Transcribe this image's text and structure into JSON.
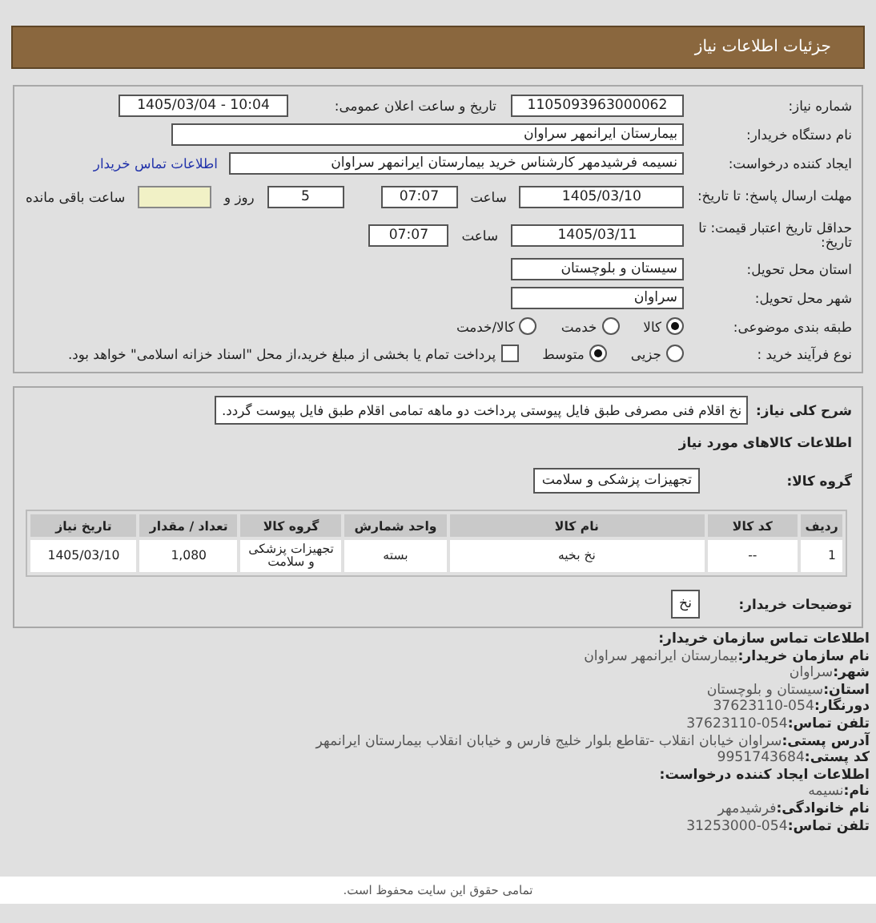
{
  "header": {
    "title": "جزئیات اطلاعات نیاز"
  },
  "need": {
    "number": {
      "label": "شماره نیاز:",
      "value": "1105093963000062"
    },
    "announce": {
      "label": "تاریخ و ساعت اعلان عمومی:",
      "value": "1405/03/04 - 10:04"
    },
    "buyer": {
      "label": "نام دستگاه خریدار:",
      "value": "بیمارستان ایرانمهر سراوان"
    },
    "creator": {
      "label": "ایجاد کننده درخواست:",
      "value": "نسیمه فرشیدمهر کارشناس خرید بیمارستان ایرانمهر سراوان",
      "link": "اطلاعات تماس خریدار"
    },
    "deadline": {
      "label": "مهلت ارسال پاسخ: تا تاریخ:",
      "date": "1405/03/10",
      "time_label": "ساعت",
      "time": "07:07",
      "days": "5",
      "days_label": "روز و",
      "remaining_label": "ساعت باقی مانده"
    },
    "validity": {
      "label": "حداقل تاریخ اعتبار قیمت: تا تاریخ:",
      "date": "1405/03/11",
      "time_label": "ساعت",
      "time": "07:07"
    },
    "province": {
      "label": "استان محل تحویل:",
      "value": "سیستان و بلوچستان"
    },
    "city": {
      "label": "شهر محل تحویل:",
      "value": "سراوان"
    },
    "category": {
      "label": "طبقه بندی موضوعی:",
      "options": [
        {
          "label": "کالا",
          "selected": true
        },
        {
          "label": "خدمت",
          "selected": false
        },
        {
          "label": "کالا/خدمت",
          "selected": false
        }
      ]
    },
    "process": {
      "label": "نوع فرآیند خرید :",
      "options": [
        {
          "label": "جزیی",
          "selected": false
        },
        {
          "label": "متوسط",
          "selected": true
        }
      ],
      "treasury": {
        "checked": false,
        "label": "پرداخت تمام یا بخشی از مبلغ خرید،از محل \"اسناد خزانه اسلامی\" خواهد بود."
      }
    }
  },
  "goods": {
    "description": {
      "label": "شرح کلی نیاز:",
      "value": "نخ اقلام فنی مصرفی طبق فایل پیوستی پرداخت دو ماهه تمامی اقلام طبق فایل پیوست گردد."
    },
    "title": "اطلاعات کالاهای مورد نیاز",
    "group": {
      "label": "گروه کالا:",
      "value": "تجهیزات پزشکی و سلامت"
    },
    "table": {
      "columns": [
        "ردیف",
        "کد کالا",
        "نام کالا",
        "واحد شمارش",
        "گروه کالا",
        "تعداد / مقدار",
        "تاریخ نیاز"
      ],
      "rows": [
        [
          "1",
          "--",
          "نخ بخیه",
          "بسته",
          "تجهیزات پزشکی و سلامت",
          "1,080",
          "1405/03/10"
        ]
      ]
    },
    "notes": {
      "label": "توضیحات خریدار:",
      "value": "نخ"
    }
  },
  "contact": {
    "title": "اطلاعات تماس سازمان خریدار:",
    "lines": [
      {
        "label": "نام سازمان خریدار:",
        "value": "بیمارستان ایرانمهر سراوان"
      },
      {
        "label": "شهر:",
        "value": "سراوان"
      },
      {
        "label": "استان:",
        "value": "سیستان و بلوچستان"
      },
      {
        "label": "دورنگار:",
        "value": "37623110-054"
      },
      {
        "label": "تلفن تماس:",
        "value": "37623110-054"
      },
      {
        "label": "آدرس پستی:",
        "value": "سراوان خیابان انقلاب -تقاطع بلوار خلیج فارس و خیابان انقلاب بیمارستان ایرانمهر"
      },
      {
        "label": "کد پستی:",
        "value": "9951743684"
      }
    ],
    "creator_title": "اطلاعات ایجاد کننده درخواست:",
    "creator_lines": [
      {
        "label": "نام:",
        "value": "نسیمه"
      },
      {
        "label": "نام خانوادگی:",
        "value": "فرشیدمهر"
      },
      {
        "label": "تلفن تماس:",
        "value": "31253000-054"
      }
    ]
  },
  "footer": {
    "text": "تمامی حقوق این سایت محفوظ است."
  }
}
